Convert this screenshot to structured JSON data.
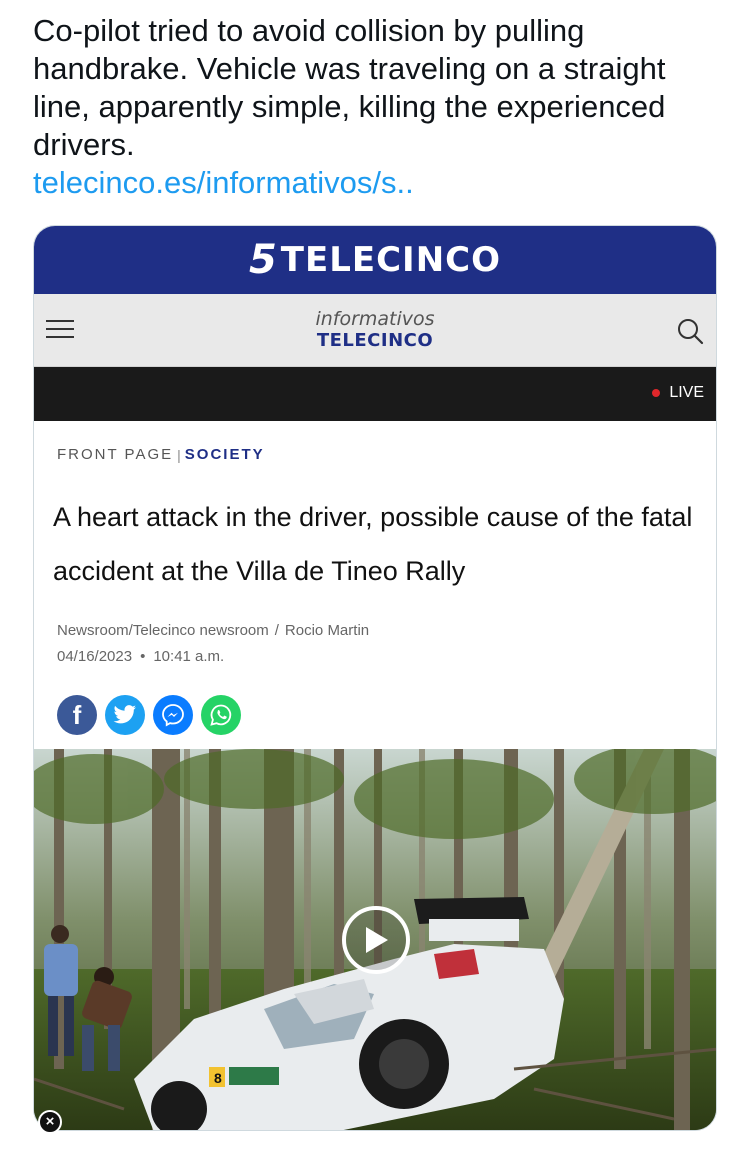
{
  "tweet": {
    "text": "Co-pilot tried to avoid collision by pulling handbrake. Vehicle was traveling on a straight line, apparently simple, killing the experienced drivers.",
    "link": "telecinco.es/informativos/s.."
  },
  "card": {
    "brand": {
      "five": "5",
      "name": "TELECINCO"
    },
    "nav": {
      "logo_top": "informativos",
      "logo_bottom": "TELECINCO",
      "menu_icon": "hamburger-icon",
      "search_icon": "search-icon"
    },
    "live": {
      "label": "LIVE",
      "dot_color": "#e0272b"
    },
    "breadcrumb": {
      "front": "FRONT PAGE",
      "separator": "|",
      "section": "SOCIETY"
    },
    "headline": "A heart attack in the driver, possible cause of the fatal accident at the Villa de Tineo Rally",
    "byline": {
      "source": "Newsroom/Telecinco newsroom",
      "separator": "/",
      "author": "Rocio Martin",
      "date": "04/16/2023",
      "time": "10:41 a.m."
    },
    "share": [
      {
        "name": "facebook",
        "glyph": "f",
        "color": "#3b5998"
      },
      {
        "name": "twitter",
        "glyph": "",
        "color": "#1da1f2"
      },
      {
        "name": "messenger",
        "glyph": "",
        "color": "#0a7cff"
      },
      {
        "name": "whatsapp",
        "glyph": "",
        "color": "#25d366"
      }
    ],
    "photo": {
      "description_icon": "play-icon",
      "car_number": "8"
    }
  },
  "colors": {
    "brand_blue": "#1f2f86",
    "link_blue": "#1d9bf0"
  }
}
